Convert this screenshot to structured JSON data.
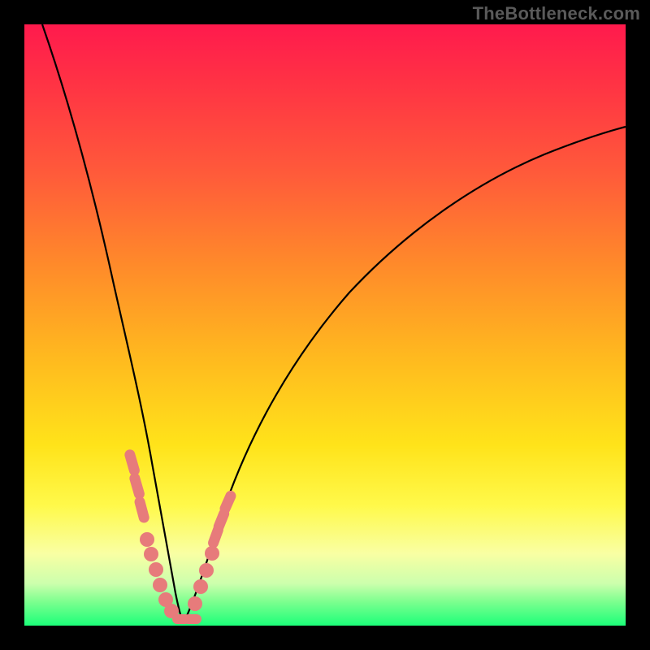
{
  "watermark": "TheBottleneck.com",
  "colors": {
    "frame": "#000000",
    "curve": "#000000",
    "marker_fill": "#e77b7b",
    "marker_stroke": "#cc5a5a",
    "gradient_top": "#ff1a4d",
    "gradient_bottom": "#1cff79"
  },
  "chart_data": {
    "type": "line",
    "title": "",
    "xlabel": "",
    "ylabel": "",
    "xlim": [
      0,
      100
    ],
    "ylim": [
      0,
      100
    ],
    "grid": false,
    "legend": false,
    "series": [
      {
        "name": "curve-left",
        "x": [
          3,
          6,
          9,
          12,
          14,
          16,
          18,
          19.5,
          21,
          22,
          23,
          24,
          25,
          26
        ],
        "y": [
          100,
          85,
          70,
          55,
          44,
          35,
          25,
          18,
          12,
          8,
          5,
          3,
          1.5,
          0.5
        ]
      },
      {
        "name": "curve-right",
        "x": [
          26,
          28,
          30,
          33,
          37,
          42,
          48,
          55,
          63,
          72,
          82,
          92,
          100
        ],
        "y": [
          0.5,
          3,
          8,
          15,
          25,
          36,
          47,
          56,
          64,
          70,
          75,
          79,
          82
        ]
      }
    ],
    "markers": [
      {
        "x": 18.0,
        "y": 27.0,
        "shape": "vbar"
      },
      {
        "x": 18.7,
        "y": 23.0,
        "shape": "vbar"
      },
      {
        "x": 19.3,
        "y": 19.0,
        "shape": "vbar"
      },
      {
        "x": 20.3,
        "y": 14.0,
        "shape": "round"
      },
      {
        "x": 21.0,
        "y": 11.5,
        "shape": "round"
      },
      {
        "x": 21.8,
        "y": 9.0,
        "shape": "round"
      },
      {
        "x": 22.5,
        "y": 6.5,
        "shape": "round"
      },
      {
        "x": 23.5,
        "y": 4.0,
        "shape": "round"
      },
      {
        "x": 24.5,
        "y": 2.2,
        "shape": "round"
      },
      {
        "x": 25.5,
        "y": 1.3,
        "shape": "hbar"
      },
      {
        "x": 27.0,
        "y": 1.3,
        "shape": "hbar"
      },
      {
        "x": 28.2,
        "y": 3.5,
        "shape": "round"
      },
      {
        "x": 29.2,
        "y": 6.5,
        "shape": "round"
      },
      {
        "x": 30.0,
        "y": 9.0,
        "shape": "round"
      },
      {
        "x": 31.0,
        "y": 12.0,
        "shape": "round"
      },
      {
        "x": 31.7,
        "y": 14.0,
        "shape": "vbar"
      },
      {
        "x": 32.6,
        "y": 16.5,
        "shape": "vbar"
      },
      {
        "x": 33.8,
        "y": 19.5,
        "shape": "vbar"
      }
    ],
    "note": "x/y are percentages of the plot area (0-100). y=0 is bottom, y=100 is top. Curve is a V-shaped valley with minimum near x≈26; markers cluster along both walls of the valley in the lower ~27% of the plot."
  }
}
